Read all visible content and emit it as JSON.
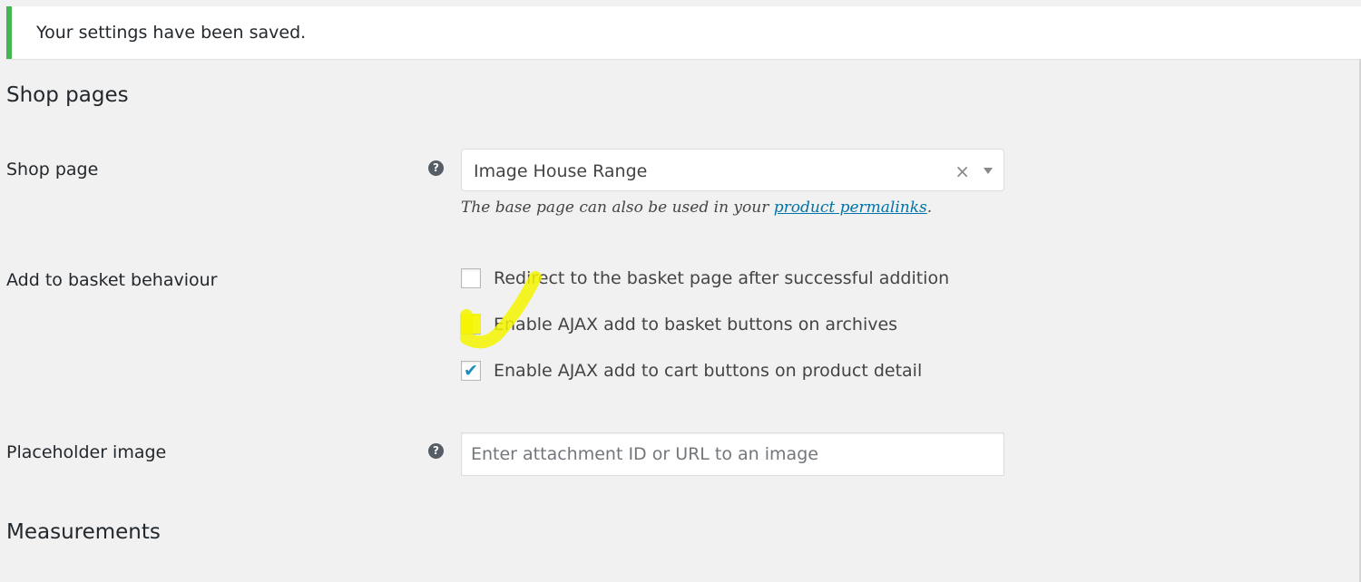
{
  "notice": {
    "message": "Your settings have been saved."
  },
  "sections": {
    "shop_pages": "Shop pages",
    "measurements": "Measurements"
  },
  "shop_page": {
    "label": "Shop page",
    "help_icon": "?",
    "selected_value": "Image House Range",
    "clear_symbol": "×",
    "description_prefix": "The base page can also be used in your ",
    "description_link": "product permalinks",
    "description_suffix": "."
  },
  "add_to_basket": {
    "label": "Add to basket behaviour",
    "options": [
      {
        "label": "Redirect to the basket page after successful addition",
        "checked": false
      },
      {
        "label": "Enable AJAX add to basket buttons on archives",
        "checked": false
      },
      {
        "label": "Enable AJAX add to cart buttons on product detail",
        "checked": true
      }
    ],
    "check_mark": "✔"
  },
  "placeholder_image": {
    "label": "Placeholder image",
    "help_icon": "?",
    "value": "",
    "placeholder": "Enter attachment ID or URL to an image"
  },
  "colors": {
    "success": "#46b450",
    "link": "#0073aa",
    "annotation": "#f5f500"
  }
}
